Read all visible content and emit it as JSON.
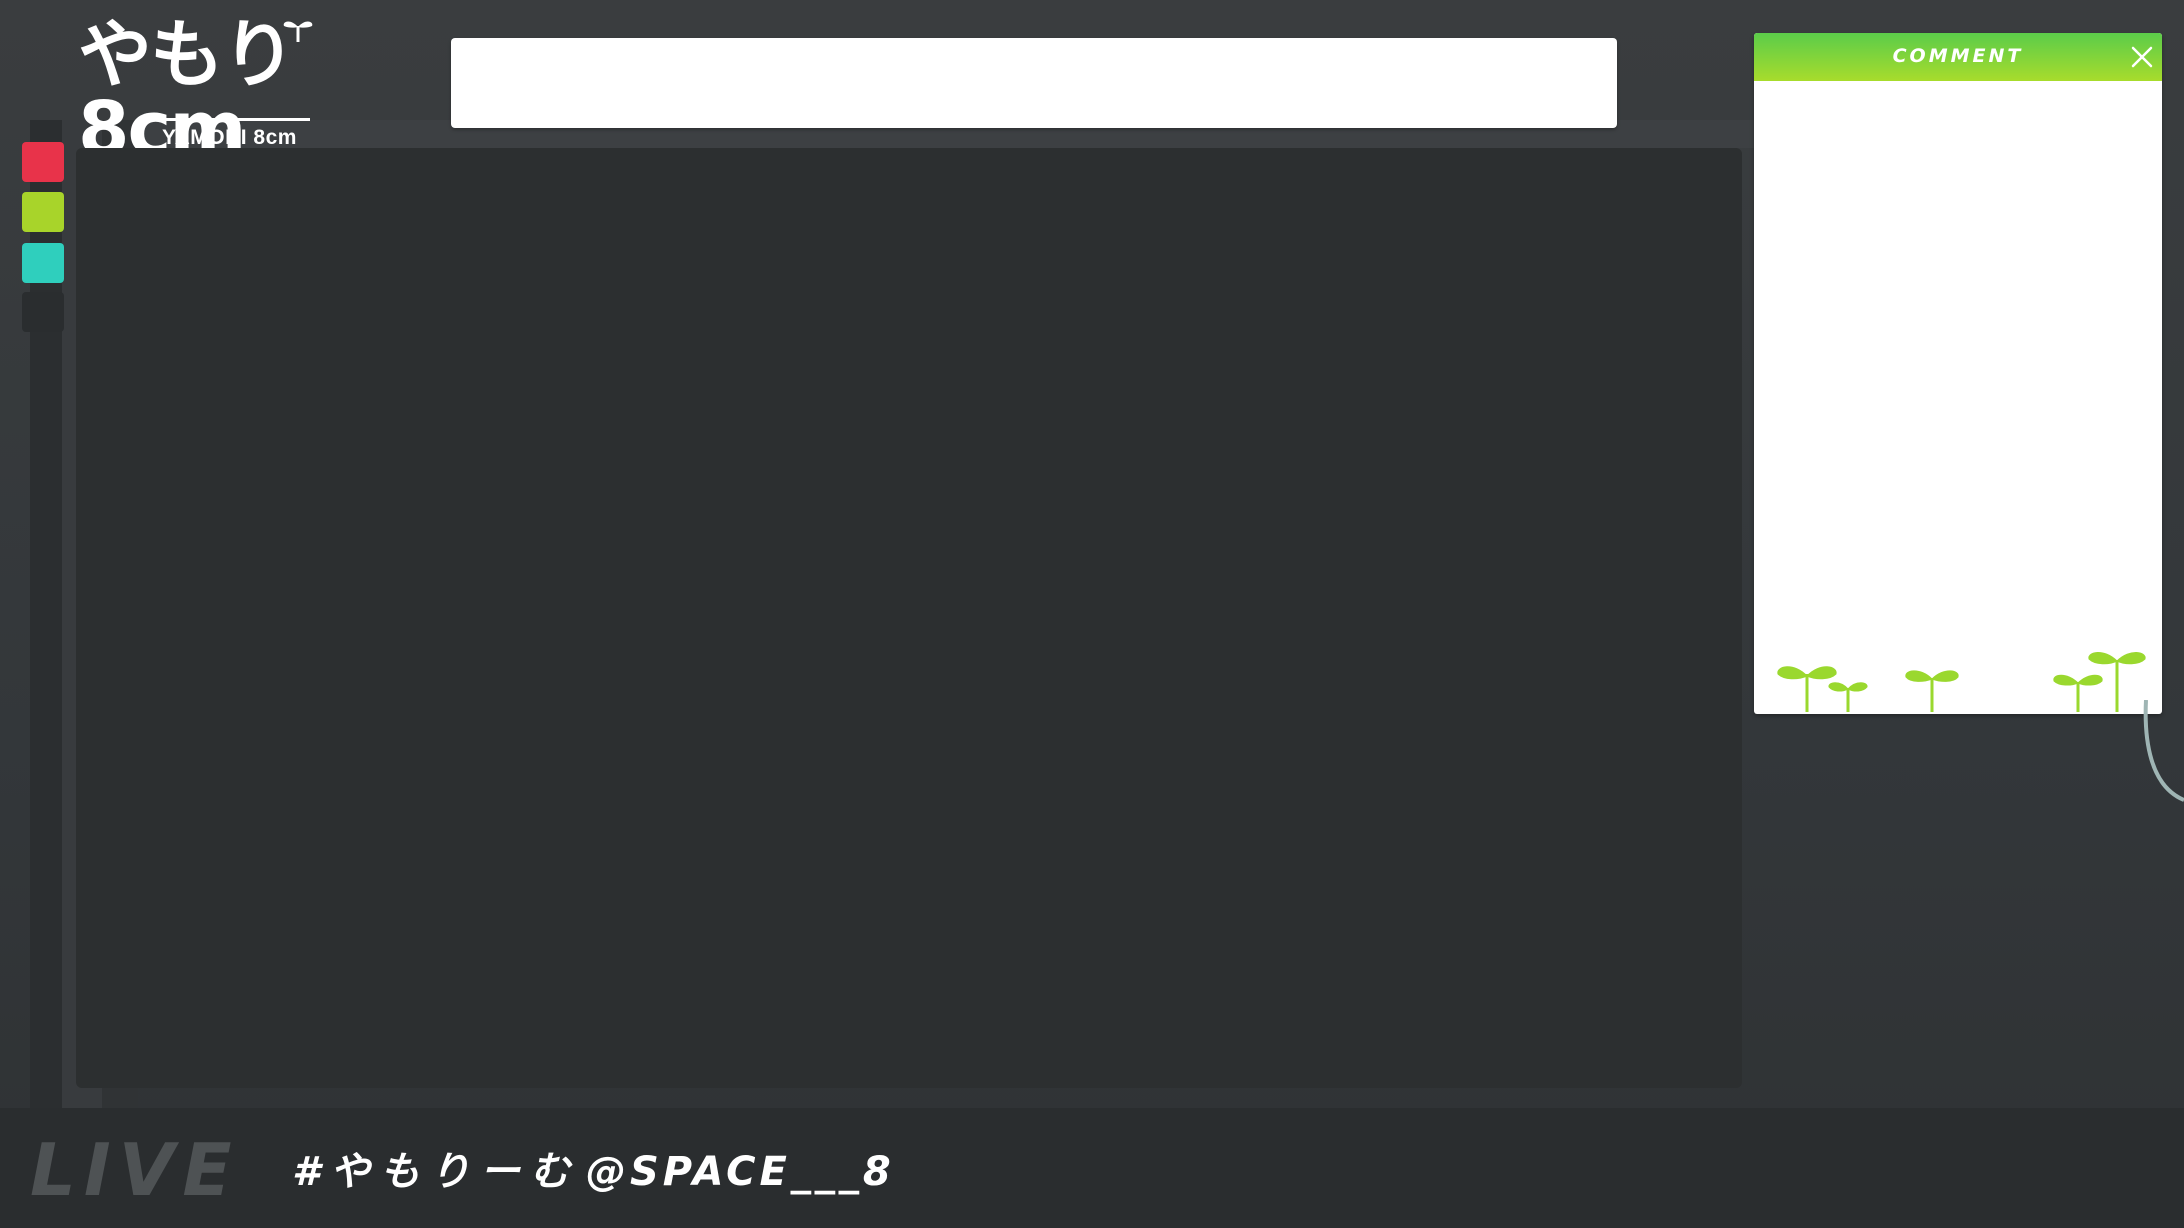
{
  "logo": {
    "main_text": "やもり8cm",
    "sub_text": "YAMORI 8cm"
  },
  "title_bar": {
    "value": ""
  },
  "palette": {
    "swatches": [
      {
        "name": "red",
        "color": "#e8334a"
      },
      {
        "name": "lime",
        "color": "#a8d42a"
      },
      {
        "name": "teal",
        "color": "#2fcfbd"
      },
      {
        "name": "dark",
        "color": "#2a2d2f"
      }
    ]
  },
  "comment_panel": {
    "title": "COMMENT",
    "close_icon": "close-icon",
    "header_color": "#8fd33a"
  },
  "footer": {
    "live_label": "LIVE",
    "hashtag": "#やもりーむ",
    "handle": "@SPACE___8"
  },
  "colors": {
    "background": "#35383b",
    "accent_green": "#a8dc2c",
    "sprout_green": "#9ad82e"
  }
}
